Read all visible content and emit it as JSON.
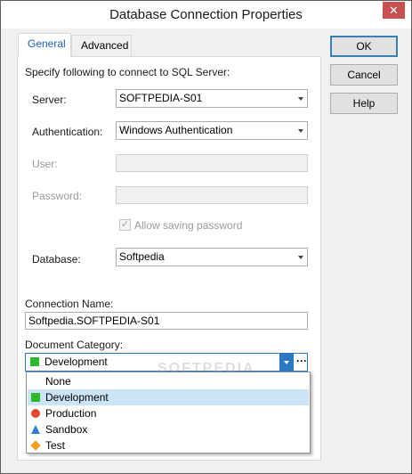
{
  "window": {
    "title": "Database Connection Properties",
    "close_glyph": "✕"
  },
  "tabs": [
    {
      "label": "General"
    },
    {
      "label": "Advanced"
    }
  ],
  "form": {
    "intro": "Specify following to connect to SQL Server:",
    "server_label": "Server:",
    "server_value": "SOFTPEDIA-S01",
    "auth_label": "Authentication:",
    "auth_value": "Windows Authentication",
    "user_label": "User:",
    "user_value": "",
    "password_label": "Password:",
    "password_value": "",
    "allow_saving_label": "Allow saving password",
    "database_label": "Database:",
    "database_value": "Softpedia",
    "connection_name_label": "Connection Name:",
    "connection_name_value": "Softpedia.SOFTPEDIA-S01",
    "document_category_label": "Document Category:",
    "document_category_value": "Development",
    "ellipsis": "···"
  },
  "category_list": [
    {
      "label": "None",
      "icon": "none"
    },
    {
      "label": "Development",
      "icon": "green-square-icon"
    },
    {
      "label": "Production",
      "icon": "red-circle-icon"
    },
    {
      "label": "Sandbox",
      "icon": "blue-triangle-icon"
    },
    {
      "label": "Test",
      "icon": "orange-diamond-icon"
    }
  ],
  "buttons": {
    "ok": "OK",
    "cancel": "Cancel",
    "help": "Help"
  },
  "watermark": "SOFTPEDIA",
  "colors": {
    "accent": "#2b78c5",
    "selection": "#cce4f7",
    "close": "#c75050"
  }
}
